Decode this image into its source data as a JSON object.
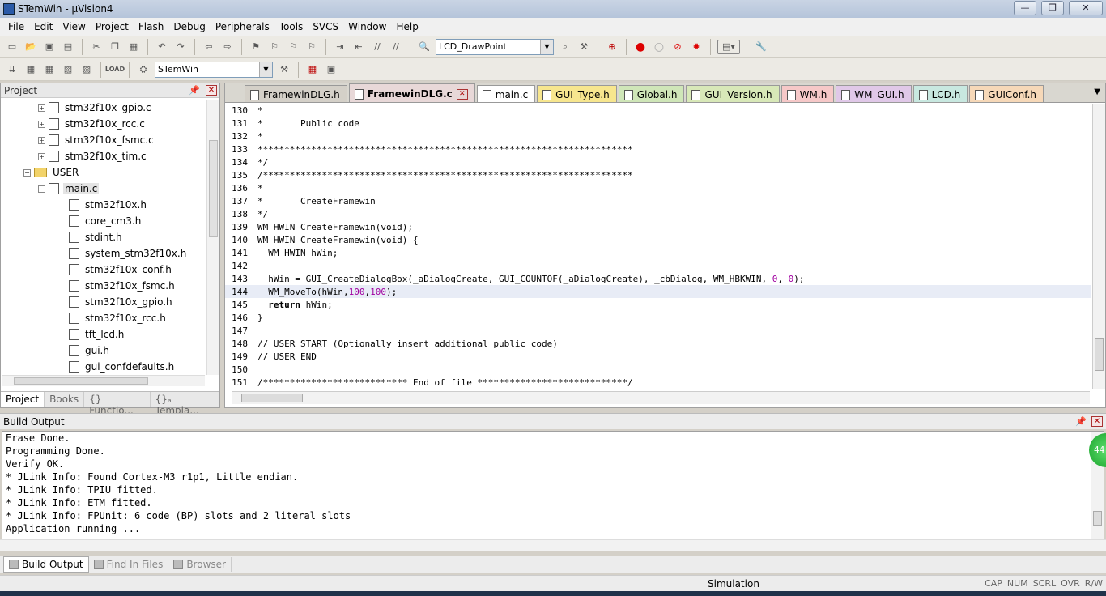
{
  "window": {
    "title": "STemWin - µVision4",
    "min": "—",
    "max": "❐",
    "close": "✕"
  },
  "menu": [
    "File",
    "Edit",
    "View",
    "Project",
    "Flash",
    "Debug",
    "Peripherals",
    "Tools",
    "SVCS",
    "Window",
    "Help"
  ],
  "toolbar": {
    "find_combo": "LCD_DrawPoint",
    "target_combo": "STemWin"
  },
  "project_panel": {
    "title": "Project",
    "tree": [
      {
        "label": "stm32f10x_gpio.c",
        "indent": 2,
        "type": "file",
        "exp": "+"
      },
      {
        "label": "stm32f10x_rcc.c",
        "indent": 2,
        "type": "file",
        "exp": "+"
      },
      {
        "label": "stm32f10x_fsmc.c",
        "indent": 2,
        "type": "file",
        "exp": "+"
      },
      {
        "label": "stm32f10x_tim.c",
        "indent": 2,
        "type": "file",
        "exp": "+"
      },
      {
        "label": "USER",
        "indent": 1,
        "type": "folder",
        "exp": "−"
      },
      {
        "label": "main.c",
        "indent": 2,
        "type": "file",
        "exp": "−",
        "selected": true
      },
      {
        "label": "stm32f10x.h",
        "indent": 3,
        "type": "doc"
      },
      {
        "label": "core_cm3.h",
        "indent": 3,
        "type": "doc"
      },
      {
        "label": "stdint.h",
        "indent": 3,
        "type": "doc"
      },
      {
        "label": "system_stm32f10x.h",
        "indent": 3,
        "type": "doc"
      },
      {
        "label": "stm32f10x_conf.h",
        "indent": 3,
        "type": "doc"
      },
      {
        "label": "stm32f10x_fsmc.h",
        "indent": 3,
        "type": "doc"
      },
      {
        "label": "stm32f10x_gpio.h",
        "indent": 3,
        "type": "doc"
      },
      {
        "label": "stm32f10x_rcc.h",
        "indent": 3,
        "type": "doc"
      },
      {
        "label": "tft_lcd.h",
        "indent": 3,
        "type": "doc"
      },
      {
        "label": "gui.h",
        "indent": 3,
        "type": "doc"
      },
      {
        "label": "gui_confdefaults.h",
        "indent": 3,
        "type": "doc"
      }
    ],
    "tabs": [
      "Project",
      "Books",
      "{} Functio...",
      "{}ₐ Templa..."
    ]
  },
  "editor": {
    "tabs": [
      {
        "label": "FramewinDLG.h",
        "color": "#d4d0c8"
      },
      {
        "label": "FramewinDLG.c",
        "color": "#e8d8d8",
        "active": true
      },
      {
        "label": "main.c",
        "color": "#ffffff"
      },
      {
        "label": "GUI_Type.h",
        "color": "#f7e68e"
      },
      {
        "label": "Global.h",
        "color": "#cfe6b8"
      },
      {
        "label": "GUI_Version.h",
        "color": "#d8e8b8"
      },
      {
        "label": "WM.h",
        "color": "#f6c8c8"
      },
      {
        "label": "WM_GUI.h",
        "color": "#e0c8e8"
      },
      {
        "label": "LCD.h",
        "color": "#c8e8e0"
      },
      {
        "label": "GUIConf.h",
        "color": "#f6d8b8"
      }
    ],
    "lines": [
      {
        "n": "130",
        "t": "*",
        "cls": "c-cmt"
      },
      {
        "n": "131",
        "t": "*       Public code",
        "cls": "c-cmt"
      },
      {
        "n": "132",
        "t": "*",
        "cls": "c-cmt"
      },
      {
        "n": "133",
        "t": "**********************************************************************",
        "cls": "c-cmt"
      },
      {
        "n": "134",
        "t": "*/",
        "cls": "c-cmt"
      },
      {
        "n": "135",
        "t": "/*********************************************************************",
        "cls": "c-cmt"
      },
      {
        "n": "136",
        "t": "*",
        "cls": "c-cmt"
      },
      {
        "n": "137",
        "t": "*       CreateFramewin",
        "cls": "c-cmt"
      },
      {
        "n": "138",
        "t": "*/",
        "cls": "c-cmt"
      },
      {
        "n": "139",
        "t": "WM_HWIN CreateFramewin(void);",
        "cls": ""
      },
      {
        "n": "140",
        "t": "WM_HWIN CreateFramewin(void) {",
        "cls": ""
      },
      {
        "n": "141",
        "t": "  WM_HWIN hWin;",
        "cls": ""
      },
      {
        "n": "142",
        "t": "",
        "cls": ""
      },
      {
        "n": "143",
        "t": "  hWin = GUI_CreateDialogBox(_aDialogCreate, GUI_COUNTOF(_aDialogCreate), _cbDialog, WM_HBKWIN, 0, 0);",
        "cls": ""
      },
      {
        "n": "144",
        "t": "  WM_MoveTo(hWin,100,100);",
        "cls": "",
        "hl": true
      },
      {
        "n": "145",
        "t": "  return hWin;",
        "cls": ""
      },
      {
        "n": "146",
        "t": "}",
        "cls": ""
      },
      {
        "n": "147",
        "t": "",
        "cls": ""
      },
      {
        "n": "148",
        "t": "// USER START (Optionally insert additional public code)",
        "cls": "c-cmt"
      },
      {
        "n": "149",
        "t": "// USER END",
        "cls": "c-cmt"
      },
      {
        "n": "150",
        "t": "",
        "cls": ""
      },
      {
        "n": "151",
        "t": "/*************************** End of file ****************************/",
        "cls": "c-cmt"
      }
    ]
  },
  "build": {
    "title": "Build Output",
    "lines": [
      "Erase Done.",
      "Programming Done.",
      "Verify OK.",
      "* JLink Info: Found Cortex-M3 r1p1, Little endian.",
      "* JLink Info: TPIU fitted.",
      "* JLink Info: ETM fitted.",
      "* JLink Info: FPUnit: 6 code (BP) slots and 2 literal slots",
      "Application running ..."
    ],
    "badge": "44",
    "tabs": [
      "Build Output",
      "Find In Files",
      "Browser"
    ]
  },
  "status": {
    "mode": "Simulation",
    "keys": [
      "CAP",
      "NUM",
      "SCRL",
      "OVR",
      "R/W"
    ]
  }
}
